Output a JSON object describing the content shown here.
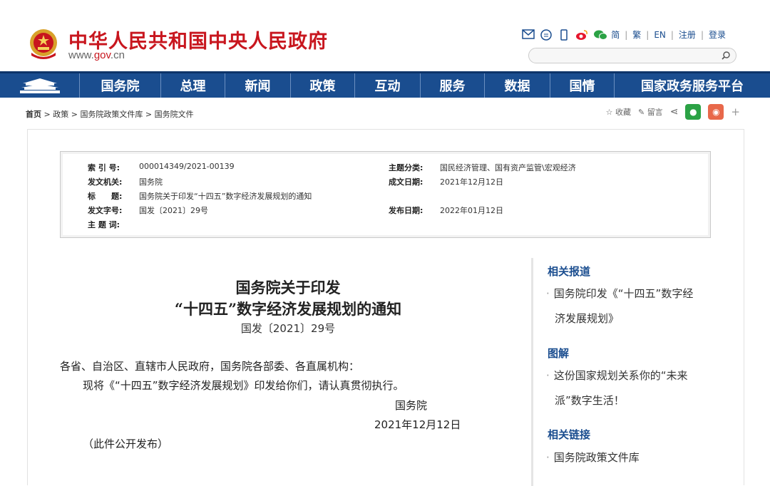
{
  "header": {
    "site_title": "中华人民共和国中央人民政府",
    "url_prefix": "www.",
    "url_highlight": "gov",
    "url_suffix": ".cn",
    "links": [
      "简",
      "繁",
      "EN",
      "注册",
      "登录"
    ],
    "icons": [
      "mail-icon",
      "chat-icon",
      "mobile-icon",
      "weibo-icon",
      "wechat-icon"
    ]
  },
  "nav": {
    "items": [
      "国务院",
      "总理",
      "新闻",
      "政策",
      "互动",
      "服务",
      "数据",
      "国情",
      "国家政务服务平台"
    ]
  },
  "breadcrumb": [
    "首页",
    "政策",
    "国务院政策文件库",
    "国务院文件"
  ],
  "share": {
    "favorite": "收藏",
    "comment": "留言"
  },
  "meta": {
    "index_label": "索 引 号:",
    "index_value": "000014349/2021-00139",
    "topic_label": "主题分类:",
    "topic_value": "国民经济管理、国有资产监管\\宏观经济",
    "issuer_label": "发文机关:",
    "issuer_value": "国务院",
    "written_label": "成文日期:",
    "written_value": "2021年12月12日",
    "title_label": "标　　题:",
    "title_value": "国务院关于印发“十四五”数字经济发展规划的通知",
    "docno_label": "发文字号:",
    "docno_value": "国发〔2021〕29号",
    "published_label": "发布日期:",
    "published_value": "2022年01月12日",
    "keywords_label": "主 题 词:",
    "keywords_value": ""
  },
  "article": {
    "title_line1": "国务院关于印发",
    "title_line2": "“十四五”数字经济发展规划的通知",
    "doc_number": "国发〔2021〕29号",
    "salutation": "各省、自治区、直辖市人民政府，国务院各部委、各直属机构：",
    "body": "现将《“十四五”数字经济发展规划》印发给你们，请认真贯彻执行。",
    "signature": "国务院",
    "date": "2021年12月12日",
    "note": "（此件公开发布）"
  },
  "sidebar": {
    "related_reports_title": "相关报道",
    "related_reports_item_l1": "国务院印发《“十四五”数字经",
    "related_reports_item_l2": "济发展规划》",
    "illustration_title": "图解",
    "illustration_item_l1": "这份国家规划关系你的“未来",
    "illustration_item_l2": "派”数字生活！",
    "related_links_title": "相关链接",
    "related_links_item": "国务院政策文件库"
  },
  "colors": {
    "brand_red": "#c8161e",
    "nav_blue": "#1a4d8f"
  }
}
